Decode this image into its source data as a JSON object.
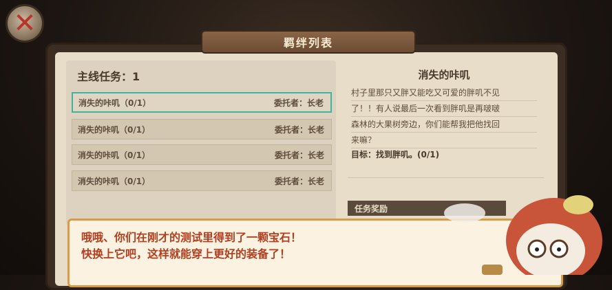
{
  "header": {
    "title": "羁绊列表"
  },
  "left": {
    "header": "主线任务：1",
    "quests": [
      {
        "name": "消失的咔叽（0/1）",
        "giver": "委托者：长老",
        "selected": true
      },
      {
        "name": "消失的咔叽（0/1）",
        "giver": "委托者：长老",
        "selected": false
      },
      {
        "name": "消失的咔叽（0/1）",
        "giver": "委托者：长老",
        "selected": false
      },
      {
        "name": "消失的咔叽（0/1）",
        "giver": "委托者：长老",
        "selected": false
      }
    ]
  },
  "detail": {
    "title": "消失的咔叽",
    "description_lines": [
      "村子里那只又胖又能吃又可爱的胖叽不见",
      "了！！有人说最后一次看到胖叽是再啵啵",
      "森林的大果树旁边，你们能帮我把他找回",
      "来嘛？"
    ],
    "goal": "目标：找到胖叽。(0/1)",
    "reward_label": "任务奖励"
  },
  "dialog": {
    "lines": [
      "哦哦、你们在刚才的测试里得到了一颗宝石！",
      "快换上它吧，这样就能穿上更好的装备了！"
    ]
  },
  "icons": {
    "close": "close-icon",
    "npc": "elder-npc-icon"
  },
  "colors": {
    "accent_selected": "#3fb39c",
    "dialog_border": "#d99a4a",
    "dialog_text": "#b13f1f"
  }
}
